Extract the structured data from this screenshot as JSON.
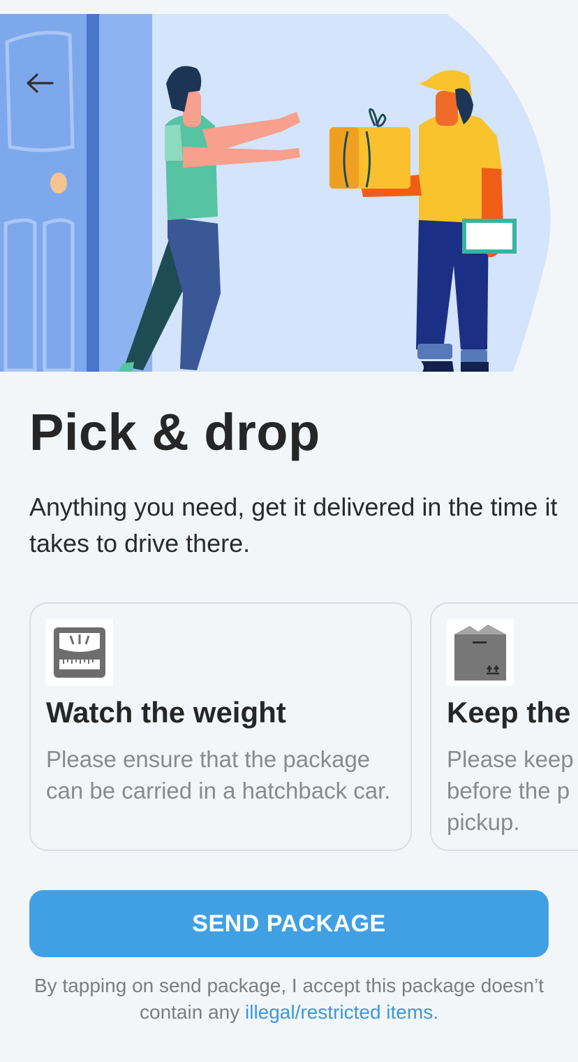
{
  "header": {
    "back_icon": "arrow-left-icon",
    "illustration_alt": "Delivery person handing a package to a customer at the door"
  },
  "main": {
    "title": "Pick & drop",
    "subtitle": "Anything you need, get it delivered in the time it takes to drive there."
  },
  "cards": [
    {
      "icon": "weighing-scale-icon",
      "title": "Watch the weight",
      "text": "Please ensure that the package can be carried in a hatchback car."
    },
    {
      "icon": "sealed-box-icon",
      "title": "Keep the",
      "text": "Please keep\nbefore the p\npickup."
    }
  ],
  "footer": {
    "button_label": "SEND PACKAGE",
    "disclaimer_prefix": "By tapping on send package, I accept this package doesn’t contain any ",
    "disclaimer_link": "illegal/restricted items."
  },
  "colors": {
    "background": "#f3f6f9",
    "accent": "#41a0e4",
    "link": "#3c98d8",
    "hero_bg": "#d6e6fb"
  }
}
